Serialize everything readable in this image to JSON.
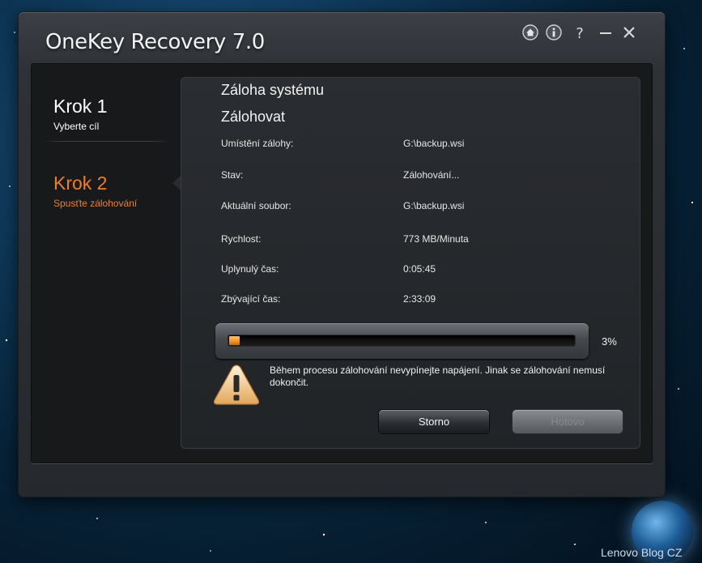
{
  "window": {
    "title": "OneKey Recovery 7.0"
  },
  "title_bar": {
    "icons": [
      "home-icon",
      "info-icon",
      "help-icon",
      "minimize-icon",
      "close-icon"
    ]
  },
  "steps": [
    {
      "title": "Krok 1",
      "subtitle": "Vyberte cíl",
      "active": false
    },
    {
      "title": "Krok 2",
      "subtitle": "Spusťte zálohování",
      "active": true
    }
  ],
  "panel": {
    "heading": "Záloha systému",
    "subheading": "Zálohovat",
    "rows": [
      {
        "label": "Umístění zálohy:",
        "value": "G:\\backup.wsi"
      },
      {
        "label": "Stav:",
        "value": "Zálohování..."
      },
      {
        "label": "Aktuální soubor:",
        "value": "G:\\backup.wsi"
      },
      {
        "label": "Rychlost:",
        "value": "773 MB/Minuta"
      },
      {
        "label": "Uplynulý čas:",
        "value": "0:05:45"
      },
      {
        "label": "Zbývající čas:",
        "value": "2:33:09"
      }
    ],
    "progress": {
      "percent": 3,
      "label": "3%"
    },
    "warning": "Během procesu zálohování nevypínejte napájení. Jinak se zálohování nemusí dokončit.",
    "buttons": {
      "cancel": "Storno",
      "done": "Hotovo"
    }
  },
  "watermark": "Lenovo Blog CZ",
  "colors": {
    "accent": "#f07f21",
    "progress": "#f68f1f"
  }
}
